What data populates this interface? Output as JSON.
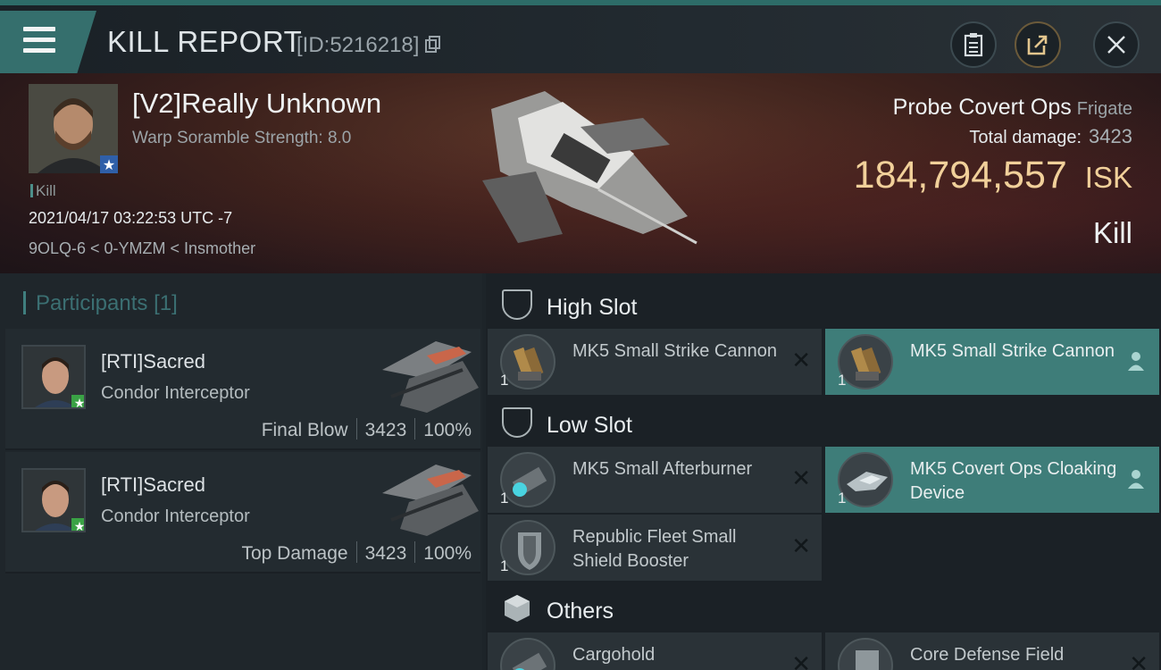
{
  "header": {
    "title": "KILL REPORT",
    "report_id": "[ID:5216218]",
    "buttons": [
      {
        "name": "clipboard-icon"
      },
      {
        "name": "share-icon"
      },
      {
        "name": "close-icon"
      }
    ],
    "accent_color": "#356f6d"
  },
  "victim": {
    "name": "[V2]Really Unknown",
    "warp_scramble": "Warp Soramble Strength: 8.0",
    "tag": "Kill",
    "datetime": "2021/04/17 03:22:53 UTC -7",
    "location": "9OLQ-6 < 0-YMZM < Insmother",
    "ship": "Probe Covert Ops",
    "ship_class": "Frigate",
    "total_damage_label": "Total damage:",
    "total_damage": "3423",
    "isk_value": "184,794,557",
    "isk_unit": "ISK",
    "result": "Kill",
    "isk_color": "#f1d09a"
  },
  "participants": {
    "label": "Participants",
    "count": "[1]",
    "rows": [
      {
        "name": "[RTI]Sacred",
        "ship": "Condor Interceptor",
        "role": "Final Blow",
        "damage": "3423",
        "percent": "100%"
      },
      {
        "name": "[RTI]Sacred",
        "ship": "Condor Interceptor",
        "role": "Top Damage",
        "damage": "3423",
        "percent": "100%"
      }
    ]
  },
  "fitting": {
    "high_slot": {
      "title": "High Slot",
      "modules": [
        {
          "qty": "1",
          "name": "MK5 Small Strike Cannon"
        },
        {
          "qty": "1",
          "name": "MK5 Small Strike Cannon"
        }
      ]
    },
    "low_slot": {
      "title": "Low Slot",
      "modules": [
        {
          "qty": "1",
          "name": "MK5 Small Afterburner"
        },
        {
          "qty": "1",
          "name": "MK5 Covert Ops Cloaking Device"
        },
        {
          "qty": "1",
          "name": "Republic Fleet Small Shield Booster"
        }
      ]
    },
    "others": {
      "title": "Others",
      "modules": [
        {
          "qty": "",
          "name": "Cargohold"
        },
        {
          "qty": "",
          "name": "Core Defense Field"
        }
      ]
    },
    "destroyed_mark": "✕",
    "dropped_color": "#3e7d79"
  }
}
